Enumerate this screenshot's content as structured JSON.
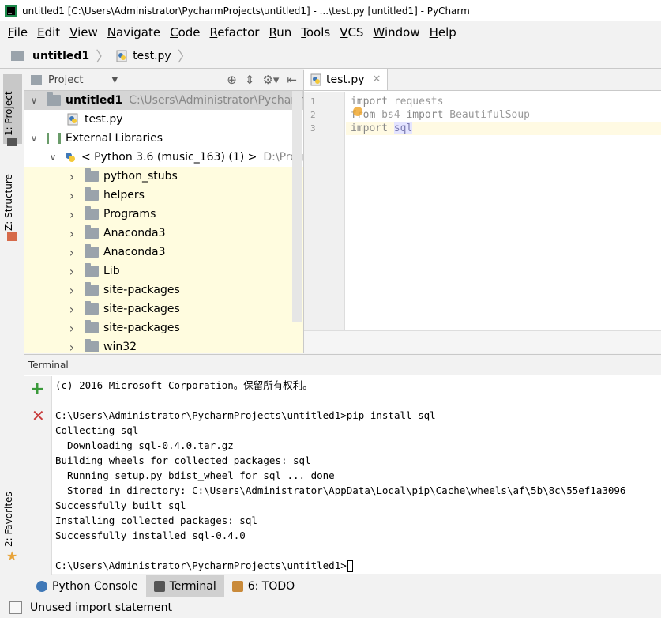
{
  "window": {
    "title": "untitled1 [C:\\Users\\Administrator\\PycharmProjects\\untitled1] - ...\\test.py [untitled1] - PyCharm"
  },
  "menu": [
    {
      "label": "File",
      "mnemonic": "F",
      "rest": "ile"
    },
    {
      "label": "Edit",
      "mnemonic": "E",
      "rest": "dit"
    },
    {
      "label": "View",
      "mnemonic": "V",
      "rest": "iew"
    },
    {
      "label": "Navigate",
      "mnemonic": "N",
      "rest": "avigate"
    },
    {
      "label": "Code",
      "mnemonic": "C",
      "rest": "ode"
    },
    {
      "label": "Refactor",
      "mnemonic": "R",
      "rest": "efactor"
    },
    {
      "label": "Run",
      "mnemonic": "R",
      "rest": "un"
    },
    {
      "label": "Tools",
      "mnemonic": "T",
      "rest": "ools"
    },
    {
      "label": "VCS",
      "mnemonic": "V",
      "rest": "CS"
    },
    {
      "label": "Window",
      "mnemonic": "W",
      "rest": "indow"
    },
    {
      "label": "Help",
      "mnemonic": "H",
      "rest": "elp"
    }
  ],
  "breadcrumb": {
    "project": "untitled1",
    "file": "test.py"
  },
  "left_strip": {
    "project_tab": "1: Project",
    "structure_tab": "Z: Structure",
    "favorites_tab": "2: Favorites"
  },
  "project_panel": {
    "header": "Project",
    "tree": {
      "root_name": "untitled1",
      "root_path": "C:\\Users\\Administrator\\PycharmPr",
      "file": "test.py",
      "external_libraries": "External Libraries",
      "sdk_name": "< Python 3.6 (music_163) (1) >",
      "sdk_path": "D:\\Progra",
      "folders": [
        "python_stubs",
        "helpers",
        "Programs",
        "Anaconda3",
        "Anaconda3",
        "Lib",
        "site-packages",
        "site-packages",
        "site-packages",
        "win32"
      ]
    }
  },
  "editor": {
    "tab_label": "test.py",
    "line_numbers": [
      "1",
      "2",
      "3"
    ],
    "lines": [
      {
        "kw": "import",
        "rest": " requests"
      },
      {
        "kw": "from",
        "mid": " bs4 ",
        "kw2": "import",
        "rest": " BeautifulSoup"
      },
      {
        "kw": "import",
        "rest": "sql"
      }
    ]
  },
  "terminal": {
    "title": "Terminal",
    "lines": [
      "(c) 2016 Microsoft Corporation。保留所有权利。",
      "",
      "C:\\Users\\Administrator\\PycharmProjects\\untitled1>pip install sql",
      "Collecting sql",
      "  Downloading sql-0.4.0.tar.gz",
      "Building wheels for collected packages: sql",
      "  Running setup.py bdist_wheel for sql ... done",
      "  Stored in directory: C:\\Users\\Administrator\\AppData\\Local\\pip\\Cache\\wheels\\af\\5b\\8c\\55ef1a3096",
      "Successfully built sql",
      "Installing collected packages: sql",
      "Successfully installed sql-0.4.0",
      "",
      "C:\\Users\\Administrator\\PycharmProjects\\untitled1>"
    ]
  },
  "bottom_tabs": [
    {
      "label": "Python Console",
      "icon": "python-icon",
      "active": false
    },
    {
      "label": "Terminal",
      "icon": "terminal-icon",
      "active": true
    },
    {
      "label": "6: TODO",
      "icon": "todo-icon",
      "active": false
    }
  ],
  "status": {
    "message": "Unused import statement"
  }
}
